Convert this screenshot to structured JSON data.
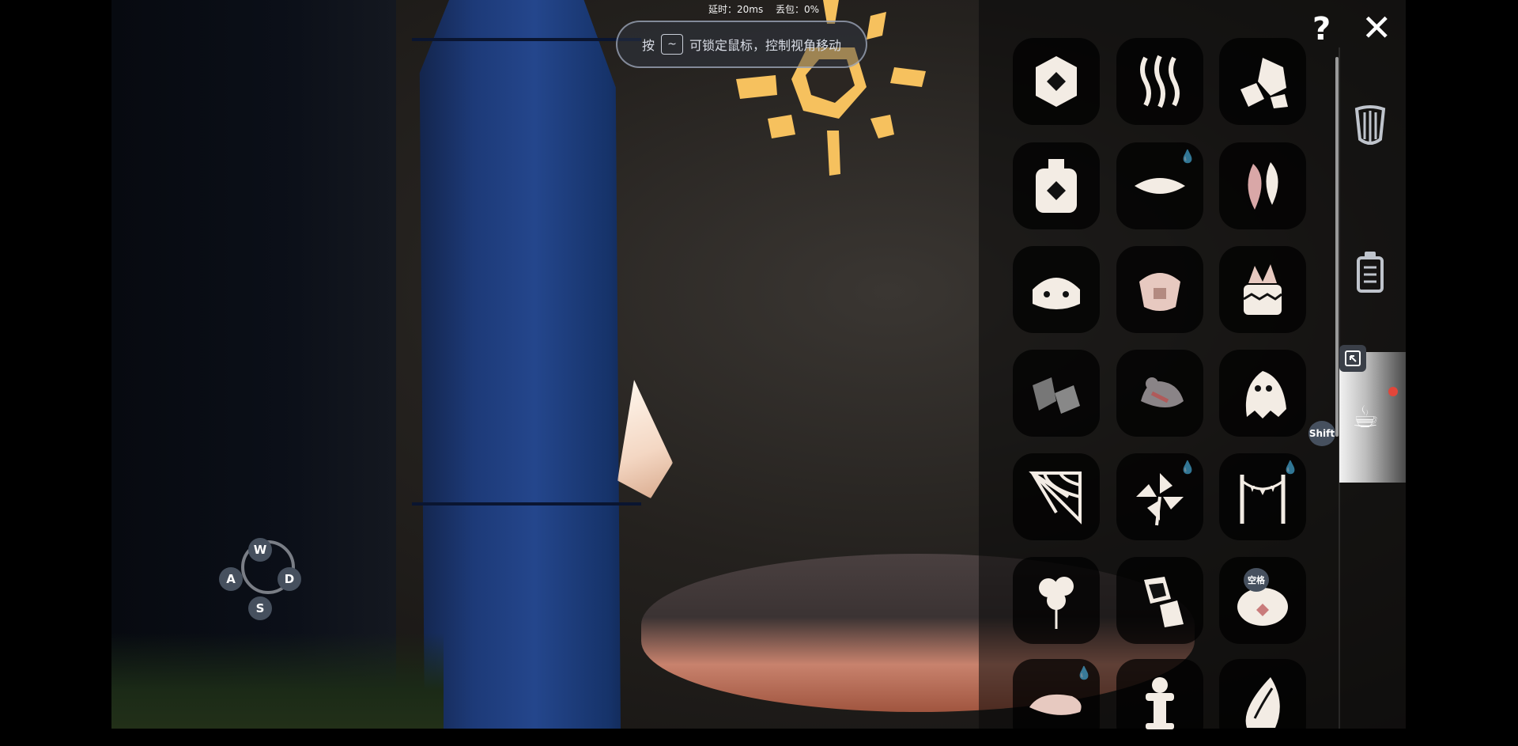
{
  "status": {
    "latency": "延时：20ms",
    "packet_loss": "丢包：0%"
  },
  "hint": {
    "prefix": "按",
    "key": "~",
    "text": "可锁定鼠标，控制视角移动"
  },
  "controls": {
    "help": "?",
    "close": "✕"
  },
  "grid": {
    "items": [
      {
        "icon": "hexagon-diamond-icon"
      },
      {
        "icon": "wavy-lines-icon"
      },
      {
        "icon": "rocks-icon"
      },
      {
        "icon": "bottle-icon"
      },
      {
        "icon": "cushion-icon",
        "drop": true
      },
      {
        "icon": "feathers-icon"
      },
      {
        "icon": "stone-stool-icon"
      },
      {
        "icon": "tea-bag-icon"
      },
      {
        "icon": "crystal-pot-icon"
      },
      {
        "icon": "boulders-icon"
      },
      {
        "icon": "pigeon-icon"
      },
      {
        "icon": "ghost-icon"
      },
      {
        "icon": "cobweb-icon"
      },
      {
        "icon": "pinwheel-icon",
        "drop": true
      },
      {
        "icon": "bunting-icon",
        "drop": true
      },
      {
        "icon": "balloons-icon"
      },
      {
        "icon": "rock-pile-icon"
      },
      {
        "icon": "pumpkin-icon"
      },
      {
        "icon": "flat-rock-icon",
        "drop": true
      },
      {
        "icon": "flower-pedestal-icon"
      },
      {
        "icon": "shell-icon"
      }
    ]
  },
  "sidebar": {
    "harp": "harp-icon",
    "trash": "trash-icon",
    "cup": "teacup-icon"
  },
  "badges": {
    "shift": "Shift",
    "space": "空格"
  },
  "wasd": {
    "up": "W",
    "left": "A",
    "right": "D",
    "down": "S"
  },
  "colors": {
    "sun": "#f6c15e",
    "icon": "#f3ece4",
    "pillar": "#24468c"
  }
}
